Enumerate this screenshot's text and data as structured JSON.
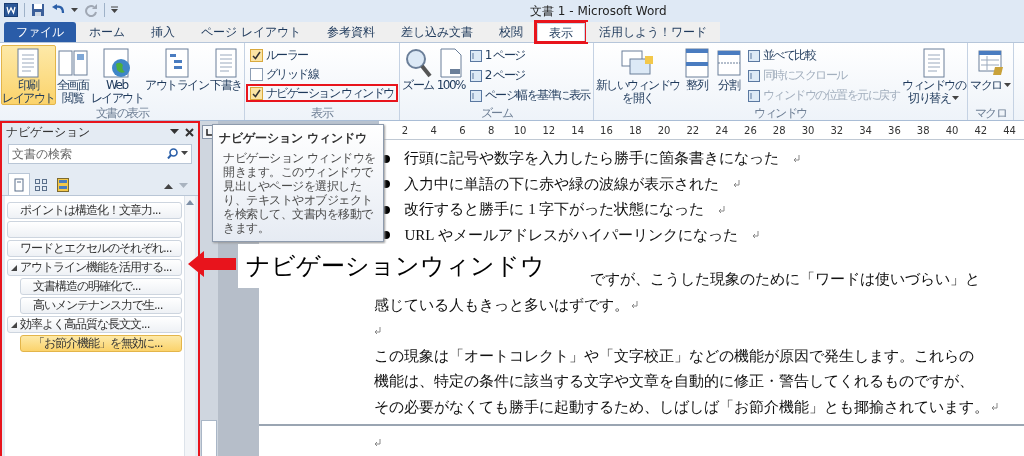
{
  "window": {
    "title": "文書 1 - Microsoft Word"
  },
  "tabs": [
    {
      "label": "ファイル",
      "kind": "file",
      "selected": false,
      "highlighted": false
    },
    {
      "label": "ホーム",
      "kind": "tab",
      "selected": false,
      "highlighted": false
    },
    {
      "label": "挿入",
      "kind": "tab",
      "selected": false,
      "highlighted": false
    },
    {
      "label": "ページ レイアウト",
      "kind": "tab",
      "selected": false,
      "highlighted": false
    },
    {
      "label": "参考資料",
      "kind": "tab",
      "selected": false,
      "highlighted": false
    },
    {
      "label": "差し込み文書",
      "kind": "tab",
      "selected": false,
      "highlighted": false
    },
    {
      "label": "校閲",
      "kind": "tab",
      "selected": false,
      "highlighted": false
    },
    {
      "label": "表示",
      "kind": "tab",
      "selected": true,
      "highlighted": true
    },
    {
      "label": "活用しよう！ワード",
      "kind": "tab",
      "selected": false,
      "highlighted": false
    }
  ],
  "ribbon": {
    "groups": [
      {
        "label": "文書の表示",
        "items": [
          {
            "kind": "large",
            "label": [
              "印刷",
              "レイアウト"
            ],
            "selected": true,
            "dropdown": false
          },
          {
            "kind": "large",
            "label": [
              "全画面",
              "閲覧"
            ],
            "selected": false,
            "dropdown": false
          },
          {
            "kind": "large",
            "label": [
              "Web",
              "レイアウト"
            ],
            "selected": false,
            "dropdown": false
          },
          {
            "kind": "large",
            "label": [
              "アウトライン"
            ],
            "selected": false,
            "dropdown": false
          },
          {
            "kind": "large",
            "label": [
              "下書き"
            ],
            "selected": false,
            "dropdown": false
          }
        ]
      },
      {
        "label": "表示",
        "items": [
          {
            "kind": "check",
            "label": "ルーラー",
            "checked": true,
            "highlighted": false
          },
          {
            "kind": "check",
            "label": "グリッド線",
            "checked": false,
            "highlighted": false
          },
          {
            "kind": "check",
            "label": "ナビゲーション ウィンドウ",
            "checked": true,
            "highlighted": true
          }
        ]
      },
      {
        "label": "ズーム",
        "items": [
          {
            "kind": "large",
            "label": [
              "ズーム"
            ],
            "selected": false,
            "dropdown": false
          },
          {
            "kind": "large",
            "label": [
              "100%"
            ],
            "selected": false,
            "dropdown": false
          },
          {
            "kind": "small",
            "label": "1 ページ",
            "disabled": false
          },
          {
            "kind": "small",
            "label": "2 ページ",
            "disabled": false
          },
          {
            "kind": "small",
            "label": "ページ幅を基準に表示",
            "disabled": false
          }
        ]
      },
      {
        "label": "ウィンドウ",
        "items": [
          {
            "kind": "large",
            "label": [
              "新しいウィンドウ",
              "を開く"
            ],
            "selected": false,
            "dropdown": false
          },
          {
            "kind": "large",
            "label": [
              "整列"
            ],
            "selected": false,
            "dropdown": false
          },
          {
            "kind": "large",
            "label": [
              "分割"
            ],
            "selected": false,
            "dropdown": false
          },
          {
            "kind": "small",
            "label": "並べて比較",
            "disabled": false
          },
          {
            "kind": "small",
            "label": "同時にスクロール",
            "disabled": true
          },
          {
            "kind": "small",
            "label": "ウィンドウの位置を元に戻す",
            "disabled": true
          },
          {
            "kind": "large",
            "label": [
              "ウィンドウの",
              "切り替え"
            ],
            "selected": false,
            "dropdown": true
          }
        ]
      },
      {
        "label": "マクロ",
        "items": [
          {
            "kind": "large",
            "label": [
              "マクロ"
            ],
            "selected": false,
            "dropdown": true
          }
        ]
      }
    ]
  },
  "navigation": {
    "title": "ナビゲーション",
    "highlighted": true,
    "search": {
      "placeholder": "文書の検索"
    },
    "tabs": [
      {
        "selected": true
      },
      {
        "selected": false
      },
      {
        "selected": false
      }
    ],
    "headings": [
      {
        "kind": "heading",
        "text": "ポイントは構造化！文章力...",
        "selected": false,
        "expanded": false
      },
      {
        "kind": "blank",
        "selected": false,
        "expanded": false
      },
      {
        "kind": "heading",
        "text": "ワードとエクセルのそれぞれ...",
        "selected": false,
        "expanded": false
      },
      {
        "kind": "heading",
        "text": "アウトライン機能を活用する...",
        "selected": false,
        "expanded": true,
        "children": [
          {
            "kind": "heading",
            "text": "文書構造の明確化で...",
            "selected": false,
            "expanded": false
          },
          {
            "kind": "heading",
            "text": "高いメンテナンス力で生...",
            "selected": false,
            "expanded": false
          }
        ]
      },
      {
        "kind": "heading",
        "text": "効率よく高品質な長文文...",
        "selected": false,
        "expanded": true,
        "children": [
          {
            "kind": "heading",
            "text": "「お節介機能」を無効に...",
            "selected": true,
            "expanded": false
          }
        ]
      }
    ]
  },
  "tooltip": {
    "title": "ナビゲーション ウィンドウ",
    "body": "ナビゲーション ウィンドウを開きます。このウィンドウで見出しやページを選択したり、テキストやオブジェクトを検索して、文書内を移動できます。"
  },
  "ruler": {
    "numbers": [
      "2",
      "4",
      "6",
      "8",
      "10",
      "12",
      "14",
      "16",
      "18",
      "20",
      "22",
      "24",
      "26",
      "28",
      "30",
      "32",
      "34",
      "36",
      "38",
      "40",
      "42",
      "44"
    ]
  },
  "document": {
    "blocks": [
      {
        "kind": "bullet",
        "text": "行頭に記号や数字を入力したら勝手に箇条書きになった",
        "mark": true
      },
      {
        "kind": "bullet",
        "text": "入力中に単語の下に赤や緑の波線が表示された",
        "mark": true
      },
      {
        "kind": "bullet",
        "text": "改行すると勝手に 1 字下がった状態になった",
        "mark": true
      },
      {
        "kind": "bullet",
        "text": "URL やメールアドレスがハイパーリンクになった",
        "mark": true
      },
      {
        "kind": "covered",
        "text": "ですが、こうした現象のために「ワードは使いづらい」と",
        "mark": false
      },
      {
        "kind": "text",
        "text": "感じている人もきっと多いはずです。",
        "mark": true
      },
      {
        "kind": "blank",
        "mark": true
      },
      {
        "kind": "text",
        "text": "この現象は「オートコレクト」や「文字校正」などの機能が原因で発生します。これらの",
        "mark": false
      },
      {
        "kind": "text",
        "text": "機能は、特定の条件に該当する文字や文章を自動的に修正・警告してくれるものですが、",
        "mark": false
      },
      {
        "kind": "text",
        "text": "その必要がなくても勝手に起動するため、しばしば「お節介機能」とも揶揄されています。",
        "mark": true
      },
      {
        "kind": "page_break"
      },
      {
        "kind": "blank",
        "mark": true
      }
    ]
  },
  "annotation": {
    "label": "ナビゲーションウィンドウ"
  }
}
